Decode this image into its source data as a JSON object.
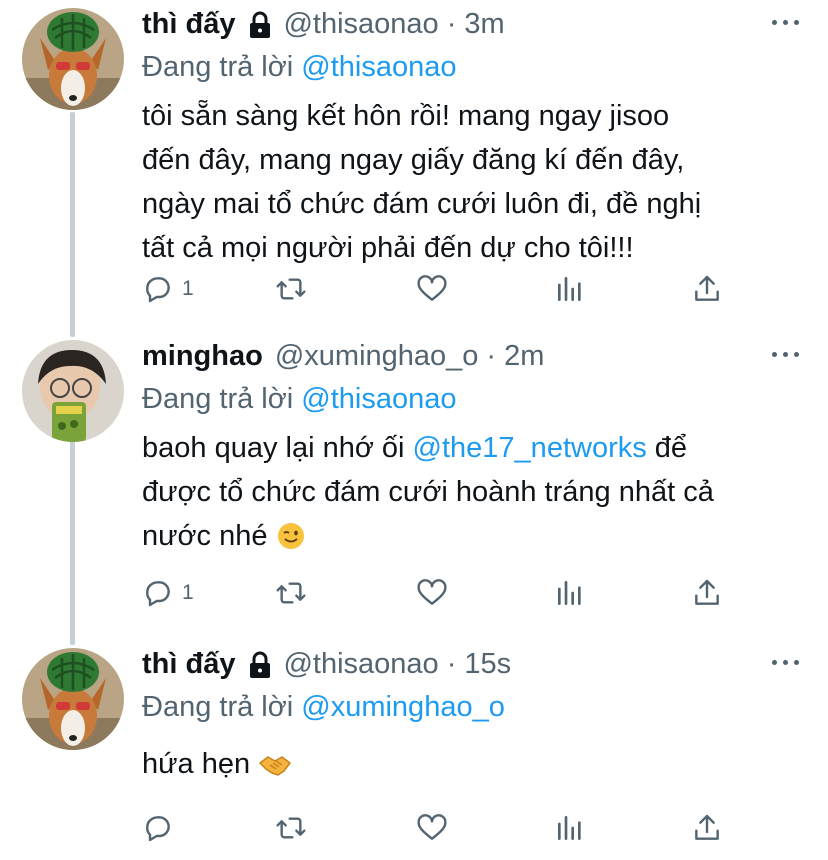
{
  "tweets": [
    {
      "name": "thì đấy",
      "locked": true,
      "handle": "@thisaonao",
      "time": "3m",
      "reply_prefix": "Đang trả lời",
      "reply_to": "@thisaonao",
      "text_lines": [
        "tôi sẵn sàng kết hôn rồi! mang ngay jisoo",
        "đến đây, mang ngay giấy đăng kí đến đây,",
        "ngày mai tổ chức đám cưới luôn đi, đề nghị",
        "tất cả mọi người phải đến dự cho tôi!!!"
      ],
      "reply_count": "1"
    },
    {
      "name": "minghao",
      "locked": false,
      "handle": "@xuminghao_o",
      "time": "2m",
      "reply_prefix": "Đang trả lời",
      "reply_to": "@thisaonao",
      "text_line1_pre": "baoh quay lại nhớ ối ",
      "text_line1_mention": "@the17_networks",
      "text_line1_post": " để",
      "text_line2": "được tổ chức đám cưới hoành tráng nhất cả",
      "text_line3": "nước nhé",
      "emoji": "wink-emoji",
      "reply_count": "1"
    },
    {
      "name": "thì đấy",
      "locked": true,
      "handle": "@thisaonao",
      "time": "15s",
      "reply_prefix": "Đang trả lời",
      "reply_to": "@xuminghao_o",
      "text_line1": "hứa hẹn",
      "emoji": "handshake-emoji",
      "reply_count": ""
    }
  ],
  "separator": "·",
  "icons": [
    "reply-icon",
    "retweet-icon",
    "like-icon",
    "analytics-icon",
    "share-icon",
    "more-icon",
    "lock-icon"
  ],
  "colors": {
    "link": "#1d9bf0",
    "secondary": "#536471",
    "thread_line": "#c4cfd6"
  }
}
